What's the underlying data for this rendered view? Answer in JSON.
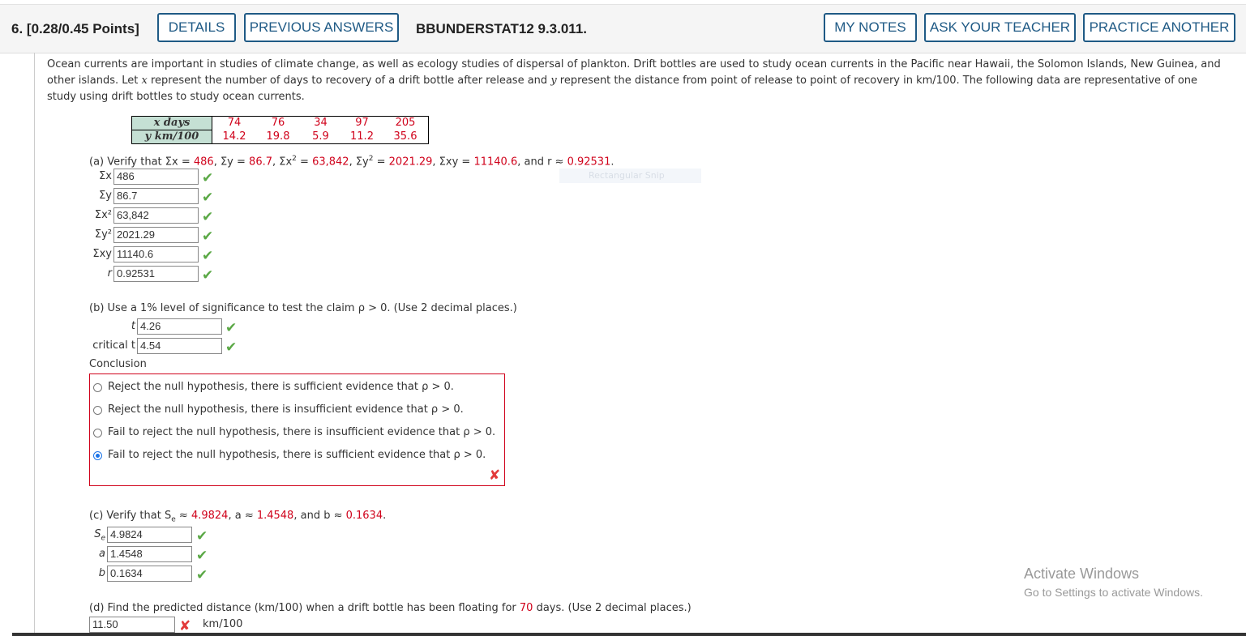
{
  "header": {
    "number": "6.",
    "points": "[0.28/0.45 Points]",
    "details": "DETAILS",
    "previous_answers": "PREVIOUS ANSWERS",
    "problem_id": "BBUNDERSTAT12 9.3.011.",
    "my_notes": "MY NOTES",
    "ask_teacher": "ASK YOUR TEACHER",
    "practice_another": "PRACTICE ANOTHER"
  },
  "intro": {
    "l1": "Ocean currents are important in studies of climate change, as well as ecology studies of dispersal of plankton. Drift bottles are used to study ocean currents in the Pacific near Hawaii, the Solomon Islands, New Guinea, and",
    "l2a": "other islands. Let ",
    "x": "x",
    "l2b": " represent the number of days to recovery of a drift bottle after release and ",
    "y": "y",
    "l2c": " represent the distance from point of release to point of recovery in km/100. The following data are representative of one",
    "l3": "study using drift bottles to study ocean currents."
  },
  "table": {
    "x_label": "x days",
    "y_label": "y km/100",
    "x": [
      "74",
      "76",
      "34",
      "97",
      "205"
    ],
    "y": [
      "14.2",
      "19.8",
      "5.9",
      "11.2",
      "35.6"
    ]
  },
  "part_a": {
    "prefix": "(a) Verify that ",
    "sx": "Σx = ",
    "sx_v": "486",
    "sy": ", Σy = ",
    "sy_v": "86.7",
    "sx2": ", Σx",
    "sx2b": " = ",
    "sx2_v": "63,842",
    "sy2": ", Σy",
    "sy2b": " = ",
    "sy2_v": "2021.29",
    "sxy": ", Σxy = ",
    "sxy_v": "11140.6",
    "r": ", and r ≈ ",
    "r_v": "0.92531",
    "end": ".",
    "fields": [
      {
        "label": "Σx",
        "value": "486"
      },
      {
        "label": "Σy",
        "value": "86.7"
      },
      {
        "label": "Σx²",
        "value": "63,842"
      },
      {
        "label": "Σy²",
        "value": "2021.29"
      },
      {
        "label": "Σxy",
        "value": "11140.6"
      },
      {
        "label": "r",
        "value": "0.92531"
      }
    ]
  },
  "part_b": {
    "question": "(b) Use a 1% level of significance to test the claim ρ > 0. (Use 2 decimal places.)",
    "t_label": "t",
    "t_value": "4.26",
    "crit_label": "critical t",
    "crit_value": "4.54",
    "conclusion_label": "Conclusion",
    "options": [
      "Reject the null hypothesis, there is sufficient evidence that ρ > 0.",
      "Reject the null hypothesis, there is insufficient evidence that ρ > 0.",
      "Fail to reject the null hypothesis, there is insufficient evidence that ρ > 0.",
      "Fail to reject the null hypothesis, there is sufficient evidence that ρ > 0."
    ],
    "selected_index": 3
  },
  "part_c": {
    "prefix": "(c) Verify that S",
    "sub": "e",
    "mid1": " ≈ ",
    "se_v": "4.9824",
    "mid2": ", a ≈ ",
    "a_v": "1.4548",
    "mid3": ", and b ≈ ",
    "b_v": "0.1634",
    "end": ".",
    "fields": [
      {
        "label": "S",
        "sub": "e",
        "value": "4.9824"
      },
      {
        "label": "a",
        "value": "1.4548"
      },
      {
        "label": "b",
        "value": "0.1634"
      }
    ]
  },
  "part_d": {
    "q1": "(d) Find the predicted distance (km/100) when a drift bottle has been floating for ",
    "days": "70",
    "q2": " days. (Use 2 decimal places.)",
    "value": "11.50",
    "unit": "km/100"
  },
  "overlay": {
    "snip": "Rectangular Snip",
    "activate": "Activate Windows",
    "activate_sub": "Go to Settings to activate Windows."
  },
  "colors": {
    "accent": "#1f5a85",
    "answer_red": "#d0021b",
    "correct": "#5aa845",
    "wrong": "#e23a3a"
  }
}
